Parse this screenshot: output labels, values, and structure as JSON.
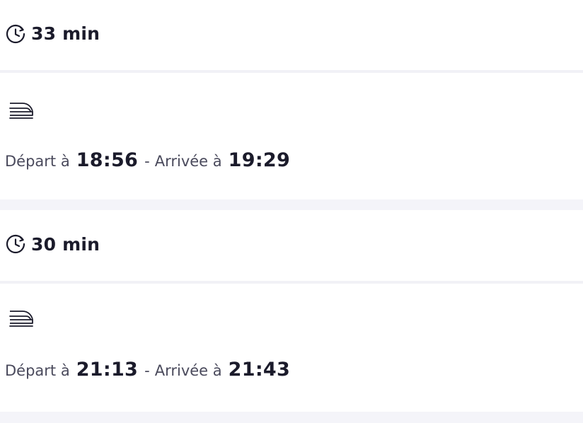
{
  "journeys": [
    {
      "duration": "33 min",
      "mode_icon": "train-icon",
      "departure_label": "Départ à",
      "departure_time": "18:56",
      "separator": "-",
      "arrival_label": "Arrivée à",
      "arrival_time": "19:29"
    },
    {
      "duration": "30 min",
      "mode_icon": "train-icon",
      "departure_label": "Départ à",
      "departure_time": "21:13",
      "separator": "-",
      "arrival_label": "Arrivée à",
      "arrival_time": "21:43"
    }
  ],
  "icons": {
    "clock": "clock-icon",
    "train": "train-icon"
  },
  "colors": {
    "text_primary": "#1b1b2b",
    "text_secondary": "#4a4a5c",
    "background": "#f4f4f9",
    "card": "#ffffff"
  }
}
